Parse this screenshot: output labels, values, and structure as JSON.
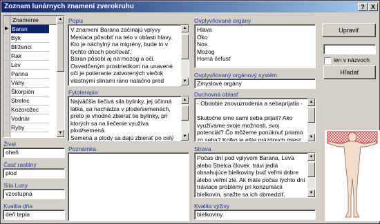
{
  "window": {
    "title": "Zoznam lunárnych znamení zverokruhu",
    "help_btn": "?",
    "close_btn": "X"
  },
  "zodiac_grid": {
    "header": "Znamenie",
    "selected_index": 0,
    "rows": [
      "Baran",
      "Býk",
      "Blíženci",
      "Rak",
      "Lev",
      "Panna",
      "Váhy",
      "Škorpión",
      "Strelec",
      "Kozorožec",
      "Vodnár",
      "Ryby"
    ]
  },
  "left_fields": {
    "zivel_label": "Živel",
    "zivel_value": "oheň",
    "cast_label": "Časť rastliny",
    "cast_value": "plod",
    "sila_label": "Sila Luny",
    "sila_value": "vzostupná",
    "kvalita_label": "Kvalita dňa",
    "kvalita_value": "deň tepla"
  },
  "popis": {
    "label": "Popis",
    "text": "V znamení Barana začínajú vplyvy Mesiaca pôsobiť na telo v oblasti hlavy. Kto je náchylný na migrény, bude to v týchto dňoch pociťovať.\nBaran pôsobí aj na mozog a oči. Osvedčeným prostriedkom na unavené oči je potieranie zatvorených viečok vlastnými slinami ráno nalačno pred umývaním, ale len pri unúdajúcom mesiaci."
  },
  "fytoterapia": {
    "label": "Fytoterapia",
    "text": "Najväčšia liečivá sila bylinky, jej účinná látka, sa nachádza v plode/semenách, preto je vhodné zbierať tie bylinky, pri ktorých sa na liečenie využíva plod/semená.\nSemená a plody sa dajú zbierať po celý"
  },
  "poznamka": {
    "label": "Poznámka",
    "text": ""
  },
  "organy": {
    "label": "Ovplyvňované orgány",
    "text": "Hlava\nOko\nNos\nMozog\nHorná čeľusť"
  },
  "system": {
    "label": "Ovplyvňovaný orgánový systém",
    "value": "Zmyslové orgány"
  },
  "duchovna": {
    "label": "Duchovná oblasť",
    "text": "- Obdobie znovuzrodenia a sebaprijatia -\n\nSkutočne sme sami seba prijali? Ako využívame svoje možnosti, svoj potenciál? Čo môžeme ponúknuť priamo zo seba? Koľko je ešte prázdnych miest, koľko"
  },
  "strava": {
    "label": "Strava",
    "text": "Počas dní pod vplyvom Barana, Leva alebo Strelca človek  trávi jedlá obsahujúce bielkoviny buď veľmi dobre alebo veľmi zle. Ak máte počas týchto dní tráviace problémy pri konzumácii  bielkovín, snažte sa ich obmedziť, prípadne nahradiť živočíšne"
  },
  "kvalita_vyzivy": {
    "label": "Kvalita výživy",
    "value": "bielkoviny"
  },
  "actions": {
    "upravit": "Upraviť",
    "search_value": "",
    "len_v_nazvoch": "len v názvoch",
    "hladat": "Hľadať"
  },
  "colors": {
    "label_blue": "#1a3aa0",
    "highlight": "#0a246a",
    "body_highlight": "#e02020"
  }
}
